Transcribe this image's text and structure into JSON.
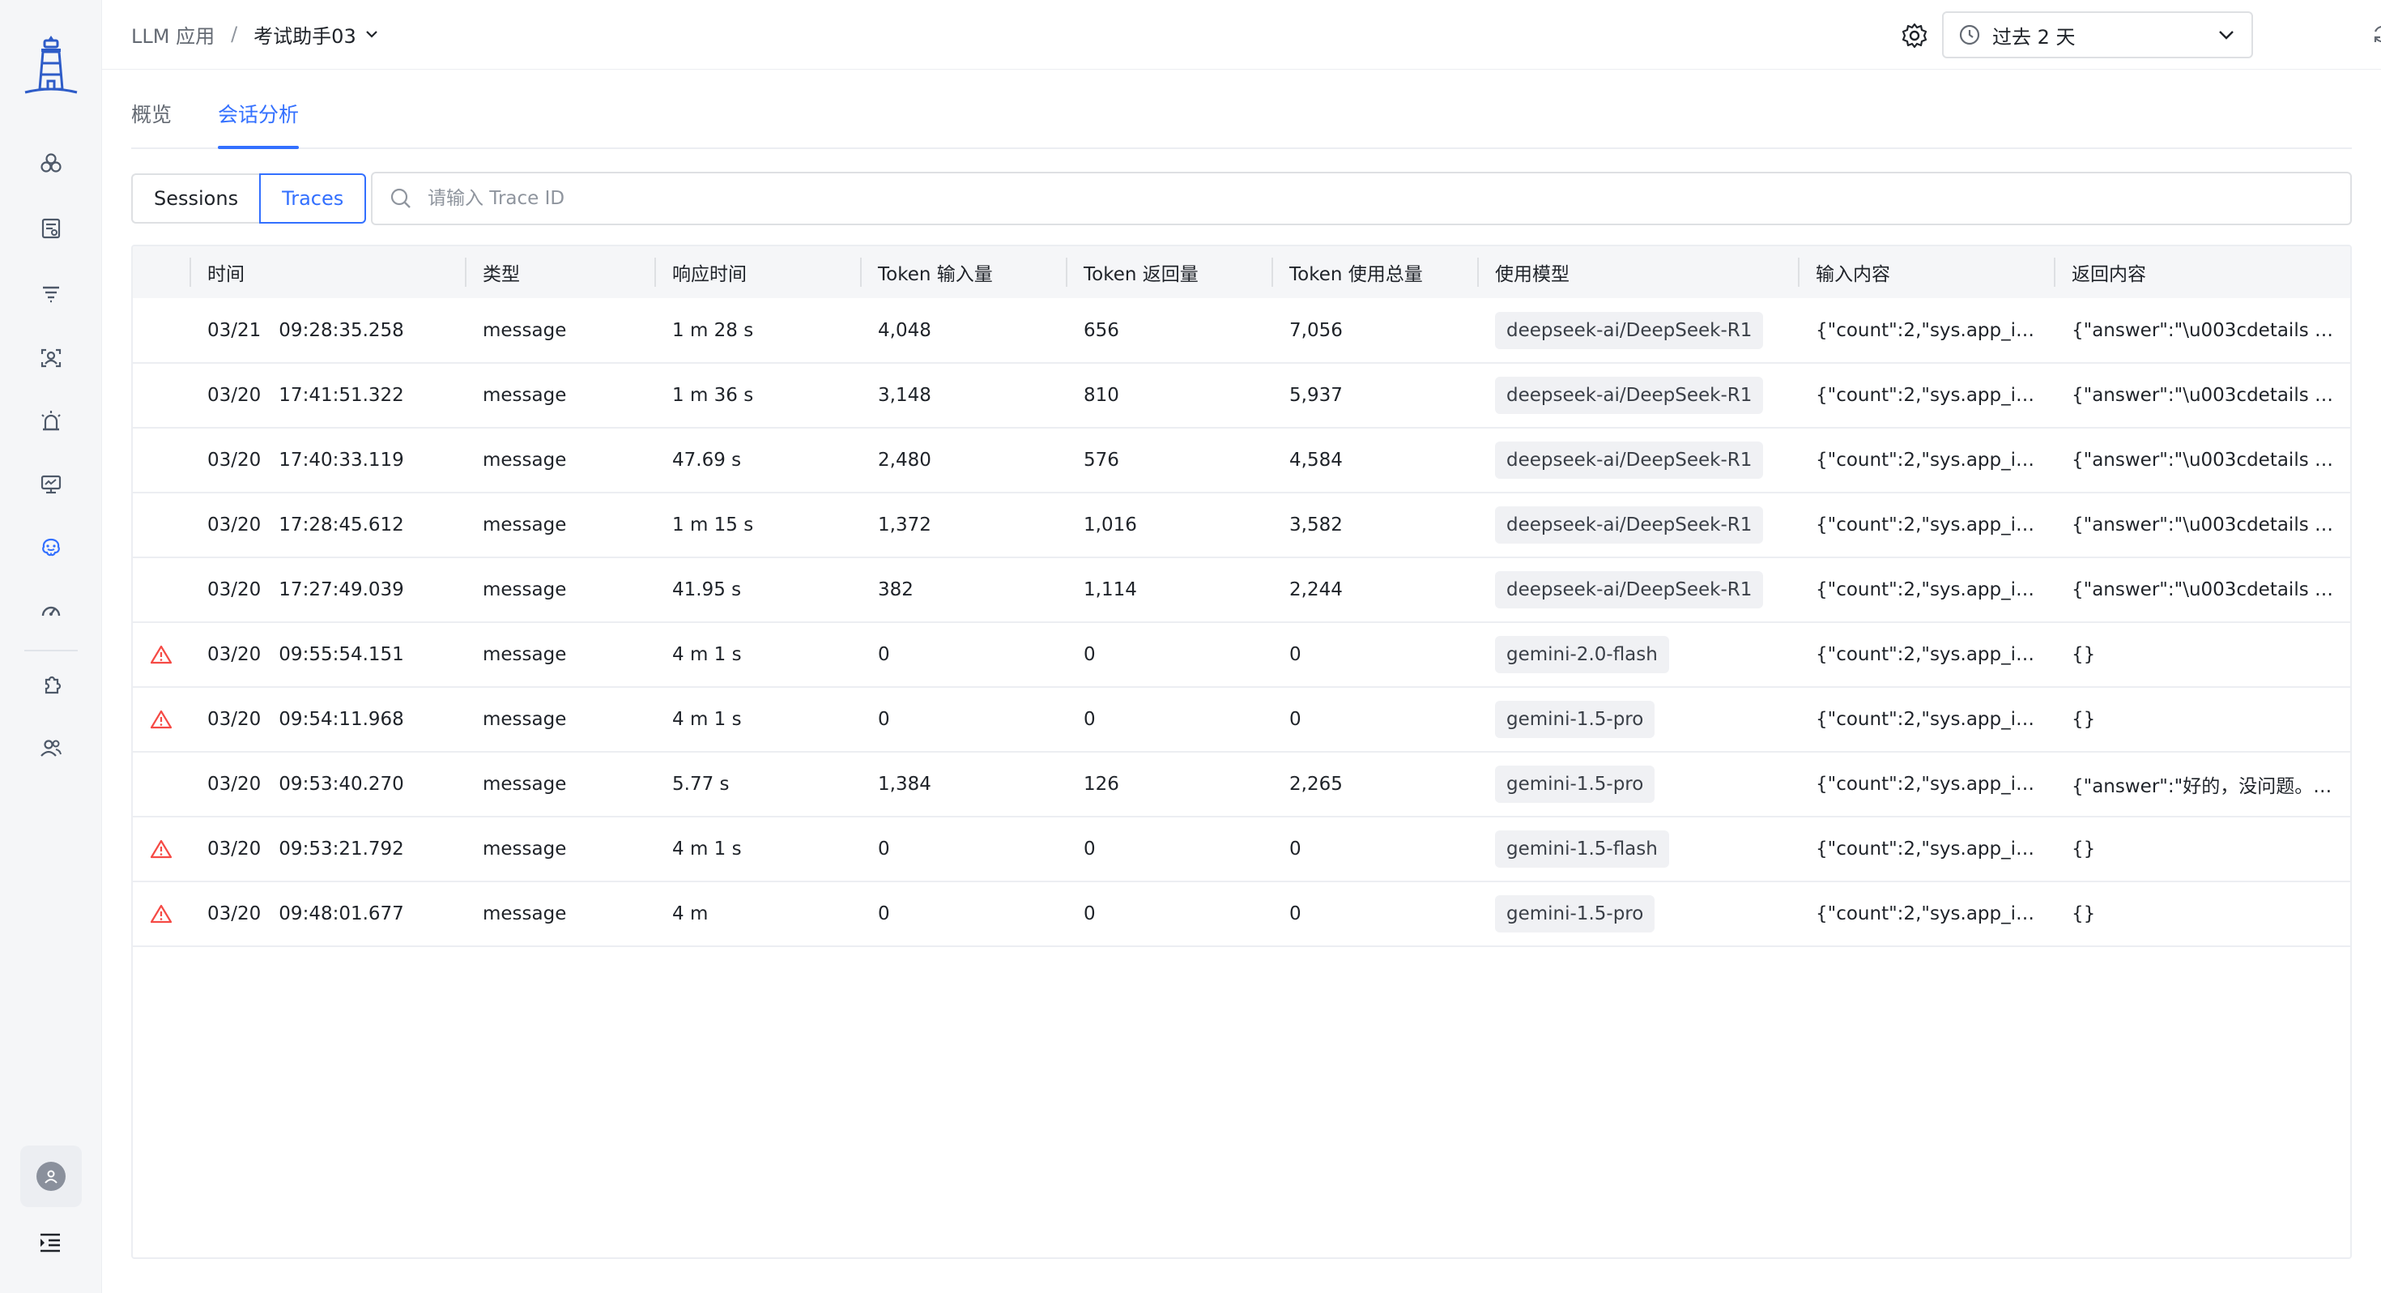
{
  "breadcrumb": {
    "root": "LLM 应用",
    "separator": "/",
    "current": "考试助手03"
  },
  "time_picker": {
    "label": "过去 2 天"
  },
  "tabs": [
    {
      "label": "概览",
      "active": false
    },
    {
      "label": "会话分析",
      "active": true
    }
  ],
  "view_toggle": [
    {
      "label": "Sessions",
      "active": false
    },
    {
      "label": "Traces",
      "active": true
    }
  ],
  "search": {
    "placeholder": "请输入 Trace ID",
    "value": ""
  },
  "table": {
    "columns": [
      "时间",
      "类型",
      "响应时间",
      "Token 输入量",
      "Token 返回量",
      "Token 使用总量",
      "使用模型",
      "输入内容",
      "返回内容"
    ],
    "rows": [
      {
        "warning": false,
        "date": "03/21",
        "time": "09:28:35.258",
        "type": "message",
        "latency": "1 m 28 s",
        "tokens_in": "4,048",
        "tokens_out": "656",
        "tokens_total": "7,056",
        "model": "deepseek-ai/DeepSeek-R1",
        "input": "{\"count\":2,\"sys.app_id...",
        "output": "{\"answer\":\"\\u003cdetails s..."
      },
      {
        "warning": false,
        "date": "03/20",
        "time": "17:41:51.322",
        "type": "message",
        "latency": "1 m 36 s",
        "tokens_in": "3,148",
        "tokens_out": "810",
        "tokens_total": "5,937",
        "model": "deepseek-ai/DeepSeek-R1",
        "input": "{\"count\":2,\"sys.app_id...",
        "output": "{\"answer\":\"\\u003cdetails s..."
      },
      {
        "warning": false,
        "date": "03/20",
        "time": "17:40:33.119",
        "type": "message",
        "latency": "47.69 s",
        "tokens_in": "2,480",
        "tokens_out": "576",
        "tokens_total": "4,584",
        "model": "deepseek-ai/DeepSeek-R1",
        "input": "{\"count\":2,\"sys.app_id...",
        "output": "{\"answer\":\"\\u003cdetails s..."
      },
      {
        "warning": false,
        "date": "03/20",
        "time": "17:28:45.612",
        "type": "message",
        "latency": "1 m 15 s",
        "tokens_in": "1,372",
        "tokens_out": "1,016",
        "tokens_total": "3,582",
        "model": "deepseek-ai/DeepSeek-R1",
        "input": "{\"count\":2,\"sys.app_id...",
        "output": "{\"answer\":\"\\u003cdetails s..."
      },
      {
        "warning": false,
        "date": "03/20",
        "time": "17:27:49.039",
        "type": "message",
        "latency": "41.95 s",
        "tokens_in": "382",
        "tokens_out": "1,114",
        "tokens_total": "2,244",
        "model": "deepseek-ai/DeepSeek-R1",
        "input": "{\"count\":2,\"sys.app_id...",
        "output": "{\"answer\":\"\\u003cdetails s..."
      },
      {
        "warning": true,
        "date": "03/20",
        "time": "09:55:54.151",
        "type": "message",
        "latency": "4 m 1 s",
        "tokens_in": "0",
        "tokens_out": "0",
        "tokens_total": "0",
        "model": "gemini-2.0-flash",
        "input": "{\"count\":2,\"sys.app_id...",
        "output": "{}"
      },
      {
        "warning": true,
        "date": "03/20",
        "time": "09:54:11.968",
        "type": "message",
        "latency": "4 m 1 s",
        "tokens_in": "0",
        "tokens_out": "0",
        "tokens_total": "0",
        "model": "gemini-1.5-pro",
        "input": "{\"count\":2,\"sys.app_id...",
        "output": "{}"
      },
      {
        "warning": false,
        "date": "03/20",
        "time": "09:53:40.270",
        "type": "message",
        "latency": "5.77 s",
        "tokens_in": "1,384",
        "tokens_out": "126",
        "tokens_total": "2,265",
        "model": "gemini-1.5-pro",
        "input": "{\"count\":2,\"sys.app_id...",
        "output": "{\"answer\":\"好的，没问题。\\..."
      },
      {
        "warning": true,
        "date": "03/20",
        "time": "09:53:21.792",
        "type": "message",
        "latency": "4 m 1 s",
        "tokens_in": "0",
        "tokens_out": "0",
        "tokens_total": "0",
        "model": "gemini-1.5-flash",
        "input": "{\"count\":2,\"sys.app_id...",
        "output": "{}"
      },
      {
        "warning": true,
        "date": "03/20",
        "time": "09:48:01.677",
        "type": "message",
        "latency": "4 m",
        "tokens_in": "0",
        "tokens_out": "0",
        "tokens_total": "0",
        "model": "gemini-1.5-pro",
        "input": "{\"count\":2,\"sys.app_id...",
        "output": "{}"
      }
    ]
  },
  "sidebar": {
    "items": [
      {
        "icon": "apps-cluster-icon"
      },
      {
        "icon": "report-list-icon"
      },
      {
        "icon": "filter-lines-icon"
      },
      {
        "icon": "user-scan-icon"
      },
      {
        "icon": "alarm-light-icon"
      },
      {
        "icon": "monitor-icon"
      },
      {
        "icon": "llm-brain-icon"
      },
      {
        "icon": "dashboard-gauge-icon"
      },
      {
        "icon": "plugin-icon"
      },
      {
        "icon": "team-icon"
      }
    ]
  },
  "colors": {
    "accent": "#3370ff",
    "warning": "#f54a45",
    "sidebar_bg": "#f5f6f8"
  }
}
